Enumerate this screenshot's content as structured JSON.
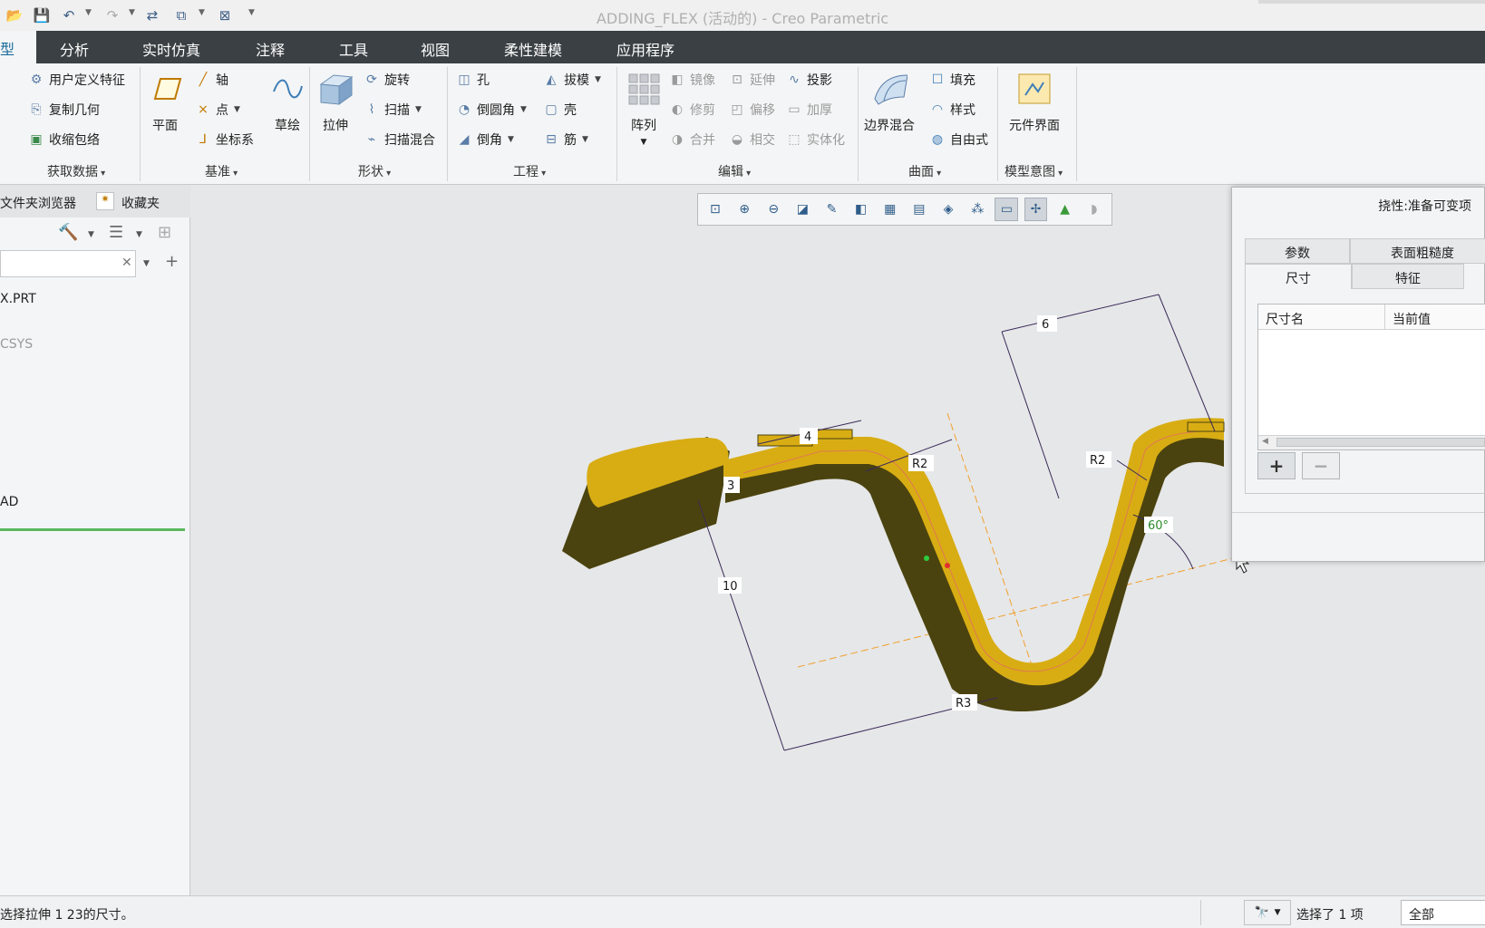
{
  "window": {
    "title": "ADDING_FLEX (活动的) - Creo Parametric"
  },
  "menu": {
    "active_tab_fragment": "型",
    "tabs": [
      "分析",
      "实时仿真",
      "注释",
      "工具",
      "视图",
      "柔性建模",
      "应用程序"
    ]
  },
  "ribbon": {
    "get_data": {
      "label": "获取数据",
      "items": [
        "用户定义特征",
        "复制几何",
        "收缩包络"
      ]
    },
    "datum": {
      "label": "基准",
      "plane": "平面",
      "axis": "轴",
      "point": "点",
      "csys": "坐标系",
      "sketch": "草绘"
    },
    "shapes": {
      "label": "形状",
      "extrude": "拉伸",
      "revolve": "旋转",
      "sweep": "扫描",
      "swept_blend": "扫描混合"
    },
    "engineering": {
      "label": "工程",
      "hole": "孔",
      "round": "倒圆角",
      "chamfer": "倒角",
      "draft": "拔模",
      "shell": "壳",
      "rib": "筋"
    },
    "editing": {
      "label": "编辑",
      "pattern": "阵列",
      "mirror": "镜像",
      "trim": "修剪",
      "merge": "合并",
      "extend": "延伸",
      "offset": "偏移",
      "intersect": "相交",
      "project": "投影",
      "thicken": "加厚",
      "solidify": "实体化"
    },
    "surfaces": {
      "label": "曲面",
      "boundary_blend": "边界混合",
      "fill": "填充",
      "style": "样式",
      "freestyle": "自由式"
    },
    "model_intent": {
      "label": "模型意图",
      "component_interface": "元件界面"
    }
  },
  "left_panel": {
    "tab_folder": "文件夹浏览器",
    "tab_favorites": "收藏夹",
    "tree_items": [
      "X.PRT",
      "CSYS",
      "AD"
    ]
  },
  "dialog": {
    "title": "挠性:准备可变项",
    "tabs_row1": [
      "参数",
      "表面粗糙度"
    ],
    "tabs_row2": [
      "尺寸",
      "特征"
    ],
    "columns": [
      "尺寸名",
      "当前值"
    ],
    "add": "+",
    "remove": "−"
  },
  "model": {
    "dims": [
      "6",
      "4",
      "R2",
      "R2",
      "3",
      "10",
      "R3",
      "60°"
    ]
  },
  "status": {
    "message": "选择拉伸 1 23的尺寸。",
    "selection": "选择了 1 项",
    "filter": "全部"
  },
  "colors": {
    "menubar": "#3a4044",
    "part_top": "#d8ad14",
    "part_side": "#4b430f",
    "dim_line": "#3a2a5a",
    "centerline": "#f0a030"
  }
}
